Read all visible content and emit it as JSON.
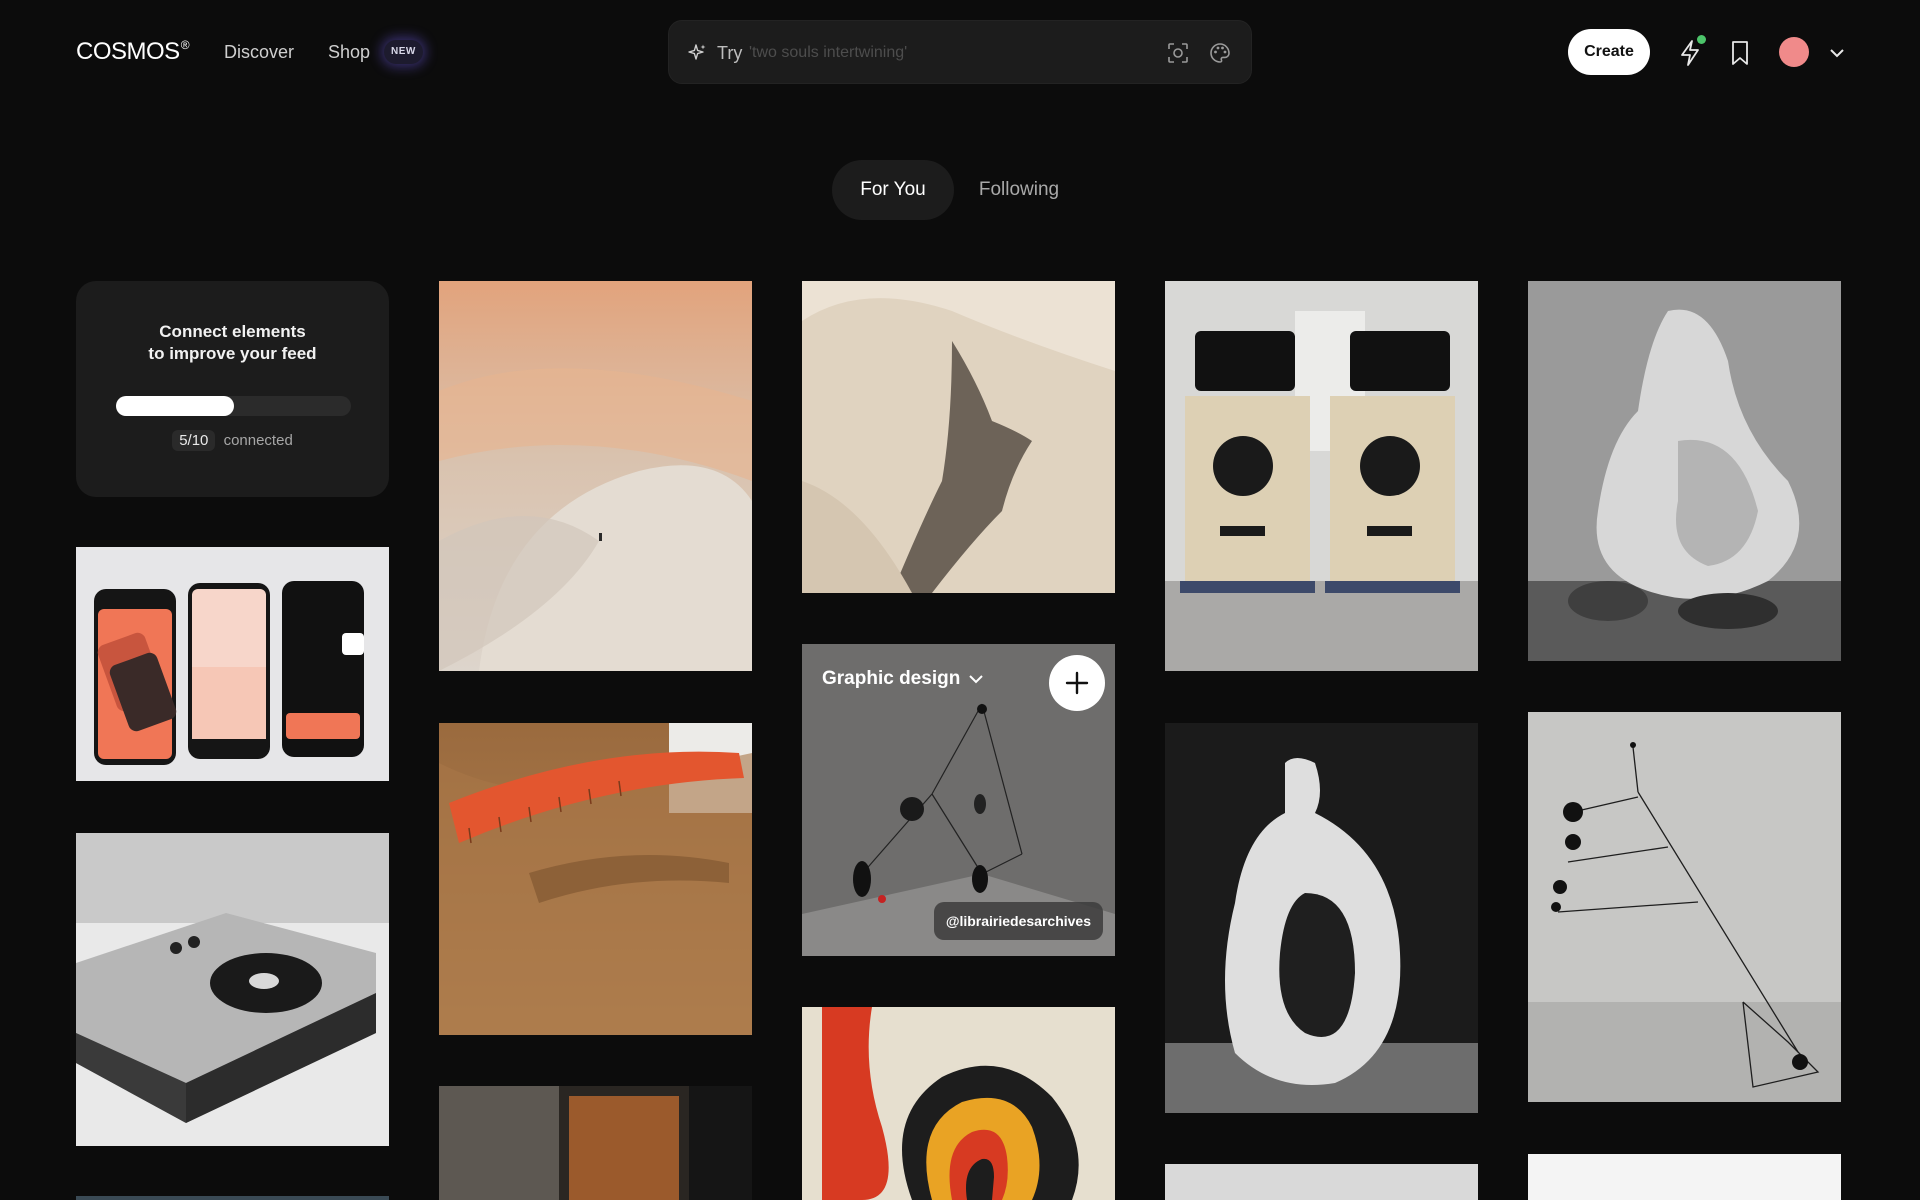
{
  "header": {
    "logo": "COSMOS",
    "logo_mark": "®",
    "nav": [
      {
        "label": "Discover"
      },
      {
        "label": "Shop"
      }
    ],
    "shop_badge": "NEW",
    "search": {
      "prefix": "Try",
      "placeholder": "'two souls intertwining'",
      "value": ""
    },
    "create_label": "Create",
    "notification_dot_color": "#4cc46a",
    "avatar_color": "#f08a8a"
  },
  "tabs": [
    {
      "label": "For You",
      "active": true
    },
    {
      "label": "Following",
      "active": false
    }
  ],
  "connect_card": {
    "title_line1": "Connect elements",
    "title_line2": "to improve your feed",
    "count": "5/10",
    "count_suffix": "connected",
    "progress": 0.5
  },
  "feed": {
    "hover_card": {
      "collection": "Graphic design",
      "handle": "@librairiedesarchives"
    }
  }
}
